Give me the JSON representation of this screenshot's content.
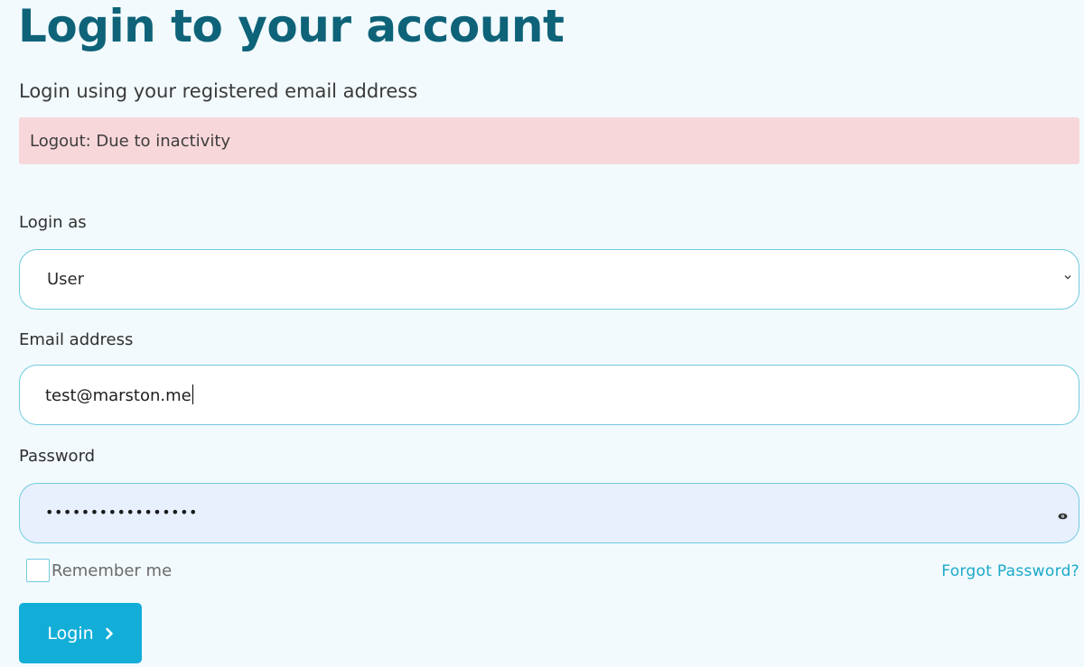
{
  "header": {
    "title": "Login to your account",
    "subtitle": "Login using your registered email address"
  },
  "alert": {
    "message": "Logout: Due to inactivity",
    "color": "#f8d7da"
  },
  "form": {
    "login_as": {
      "label": "Login as",
      "selected": "User"
    },
    "email": {
      "label": "Email address",
      "value": "test@marston.me"
    },
    "password": {
      "label": "Password",
      "masked_value": "•••••••••••••••••"
    },
    "remember_me": {
      "label": "Remember me",
      "checked": false
    },
    "forgot_password": "Forgot Password?",
    "submit_label": "Login"
  },
  "icons": {
    "select": "chevron-down-icon",
    "password": "eye-icon",
    "submit": "chevron-right-icon"
  },
  "colors": {
    "title": "#0e6379",
    "accent": "#12aed8",
    "link": "#1ba9c9",
    "field_border": "#72cbdf"
  }
}
